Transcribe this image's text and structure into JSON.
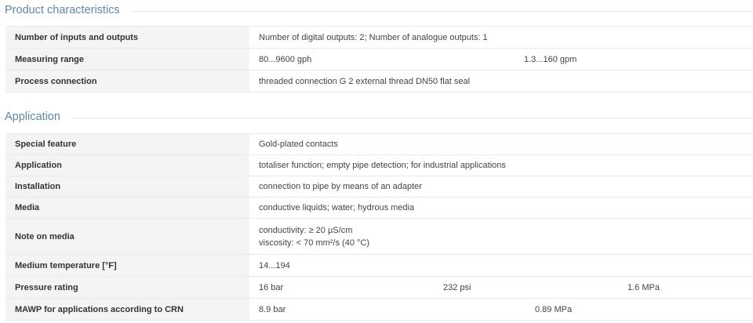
{
  "sections": [
    {
      "title": "Product characteristics",
      "rows": [
        {
          "label": "Number of inputs and outputs",
          "values": [
            "Number of digital outputs: 2; Number of analogue outputs: 1"
          ]
        },
        {
          "label": "Measuring range",
          "values": [
            "80...9600 gph",
            "1.3...160 gpm"
          ]
        },
        {
          "label": "Process connection",
          "values": [
            "threaded connection G 2 external thread DN50 flat seal"
          ]
        }
      ]
    },
    {
      "title": "Application",
      "rows": [
        {
          "label": "Special feature",
          "values": [
            "Gold-plated contacts"
          ]
        },
        {
          "label": "Application",
          "values": [
            "totaliser function; empty pipe detection; for industrial applications"
          ]
        },
        {
          "label": "Installation",
          "values": [
            "connection to pipe by means of an adapter"
          ]
        },
        {
          "label": "Media",
          "values": [
            "conductive liquids; water; hydrous media"
          ]
        },
        {
          "label": "Note on media",
          "lines": [
            "conductivity: ≥ 20 µS/cm",
            "viscosity: < 70 mm²/s (40 °C)"
          ]
        },
        {
          "label": "Medium temperature [°F]",
          "values": [
            "14...194"
          ]
        },
        {
          "label": "Pressure rating",
          "values": [
            "16 bar",
            "232 psi",
            "1.6 MPa"
          ]
        },
        {
          "label": "MAWP for applications according to CRN",
          "values": [
            "8.9 bar",
            "0.89 MPa"
          ]
        }
      ]
    }
  ]
}
